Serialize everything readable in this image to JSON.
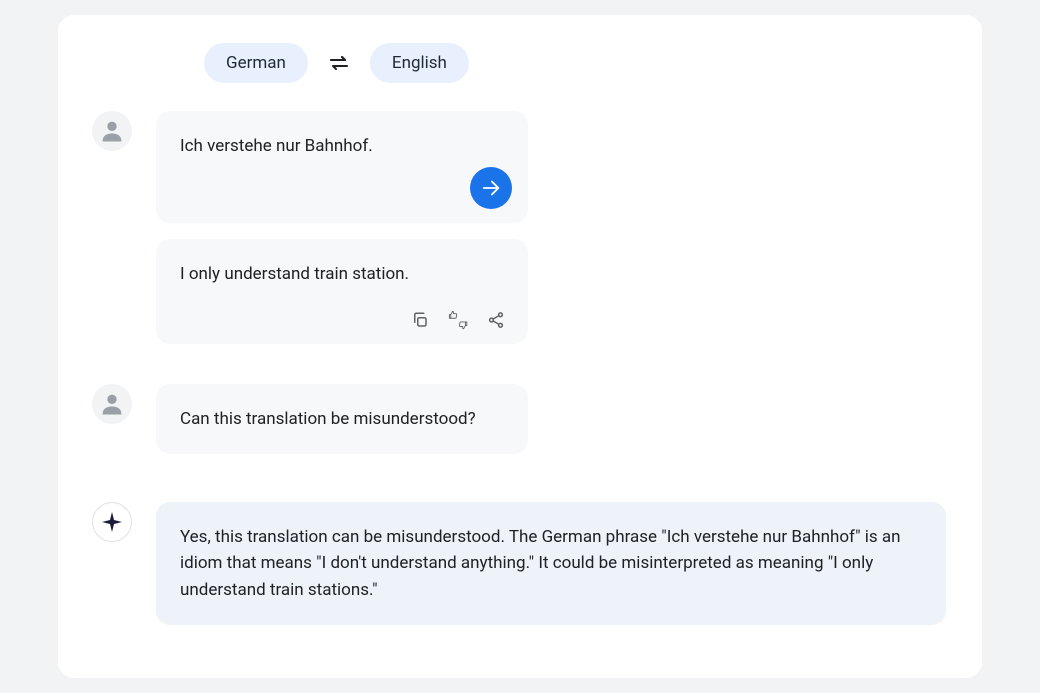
{
  "lang": {
    "source": "German",
    "target": "English"
  },
  "translation": {
    "input": "Ich verstehe nur Bahnhof.",
    "output": "I only understand train station."
  },
  "conversation": {
    "user_question": "Can this translation be misunderstood?",
    "ai_answer": "Yes, this translation can be misunderstood. The German phrase \"Ich verstehe nur Bahnhof\" is an idiom that means \"I don't understand anything.\" It could be misinterpreted as meaning \"I only understand train stations.\""
  }
}
